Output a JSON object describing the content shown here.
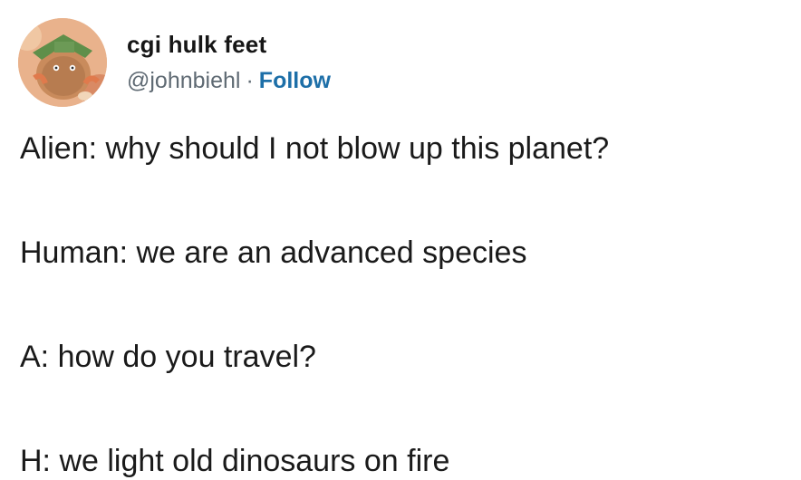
{
  "tweet": {
    "author": {
      "display_name": "cgi hulk feet",
      "handle": "@johnbiehl",
      "separator": "·",
      "follow_label": "Follow"
    },
    "lines": [
      "Alien: why should I not blow up this planet?",
      "Human: we are an advanced species",
      "A: how do you travel?",
      "H: we light old dinosaurs on fire"
    ]
  },
  "colors": {
    "follow": "#1d6fa8",
    "handle": "#5f6a73",
    "text": "#1a1a1a",
    "background": "#ffffff"
  }
}
